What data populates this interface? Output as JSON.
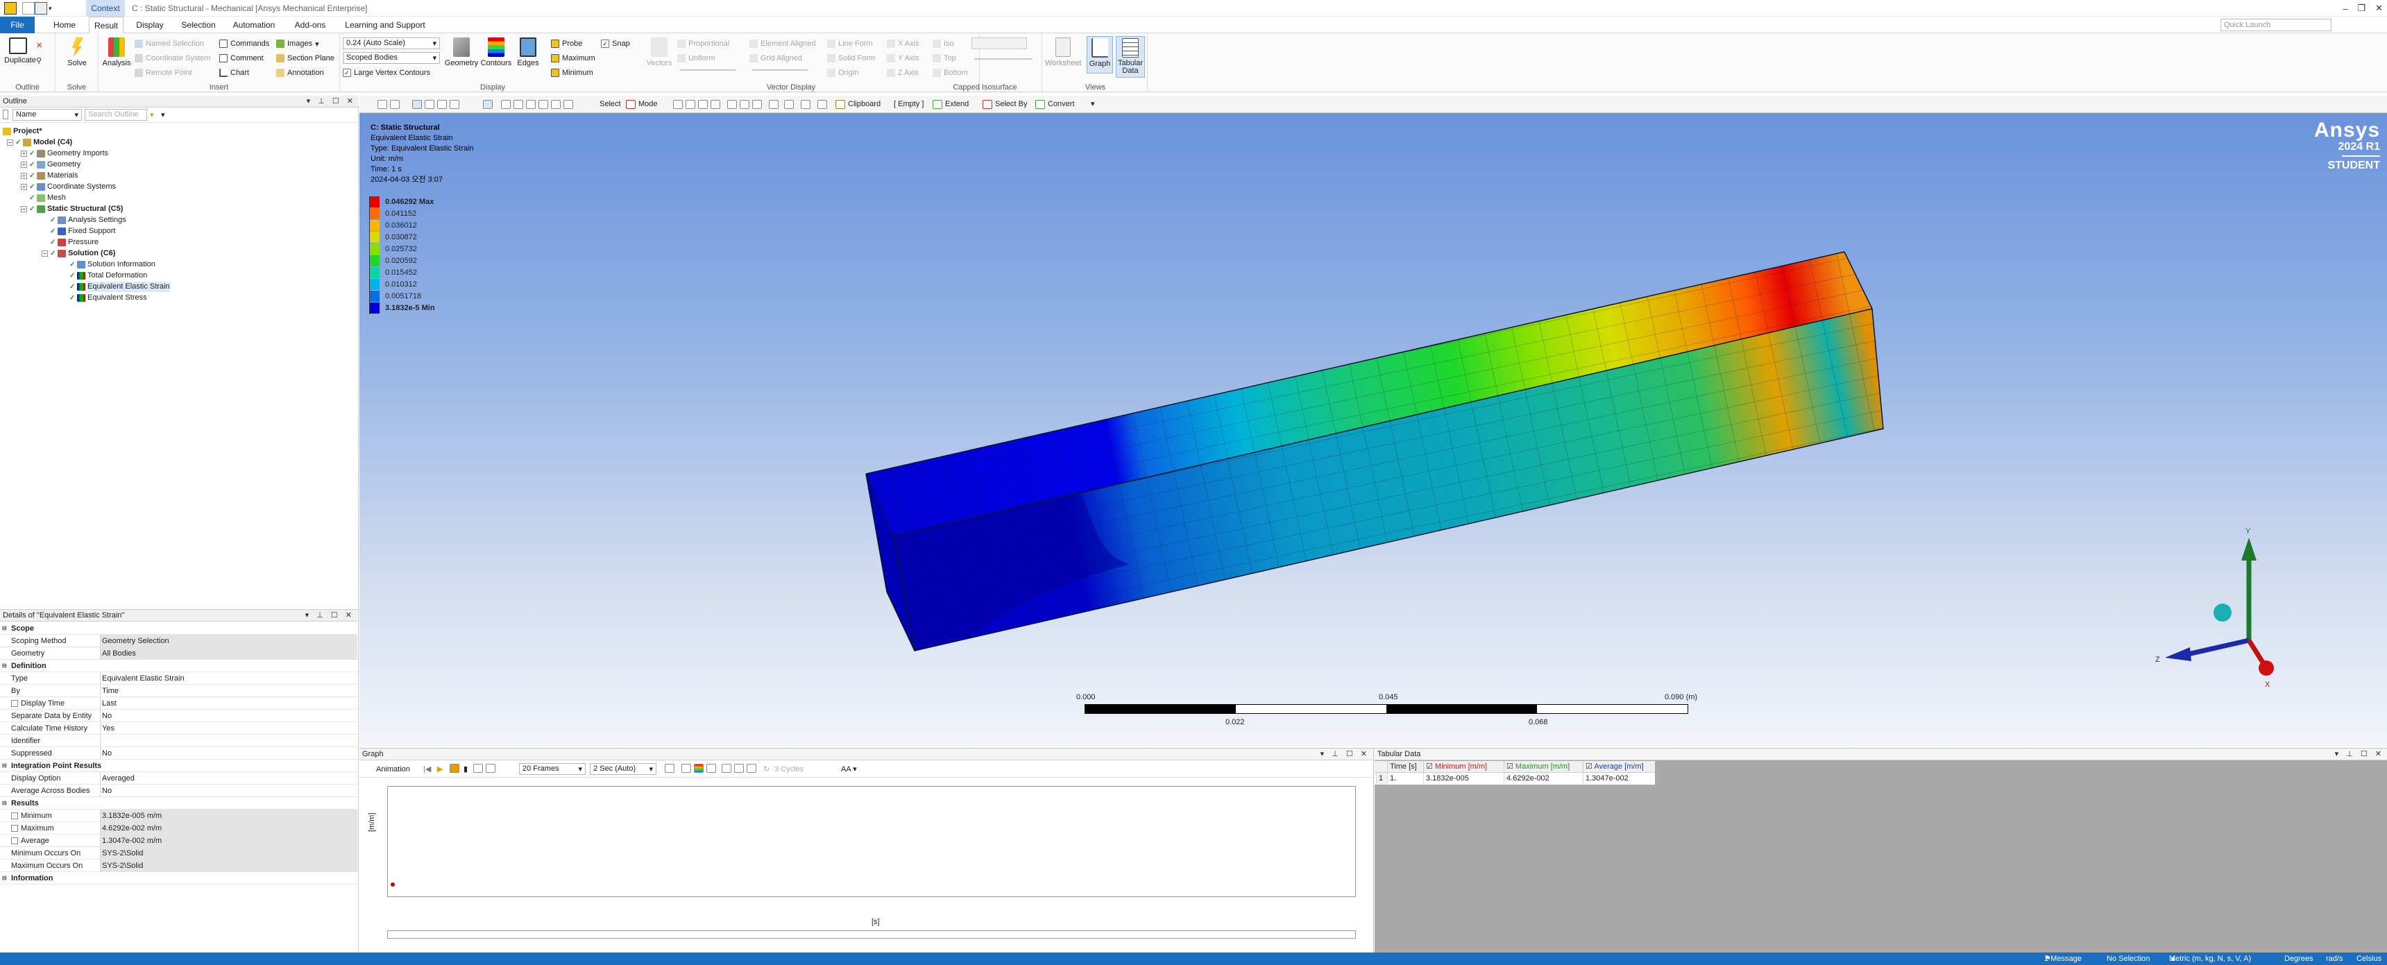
{
  "window": {
    "context_tab": "Context",
    "title": "C : Static Structural - Mechanical [Ansys Mechanical Enterprise]",
    "controls": [
      "–",
      "❐",
      "✕"
    ]
  },
  "menu": {
    "tabs": [
      "File",
      "Home",
      "Result",
      "Display",
      "Selection",
      "Automation",
      "Add-ons",
      "Learning and Support"
    ],
    "active": "Result",
    "quick_launch_placeholder": "Quick Launch"
  },
  "ribbon": {
    "outline_group": {
      "label": "Outline",
      "duplicate": "Duplicate"
    },
    "solve_group": {
      "label": "Solve",
      "solve": "Solve"
    },
    "insert_group": {
      "label": "Insert",
      "analysis": "Analysis",
      "named_selection": "Named Selection",
      "coordinate_system": "Coordinate System",
      "remote_point": "Remote Point",
      "commands": "Commands",
      "comment": "Comment",
      "chart": "Chart",
      "images": "Images",
      "section_plane": "Section Plane",
      "annotation": "Annotation"
    },
    "display_group": {
      "label": "Display",
      "scale_value": "0.24 (Auto Scale)",
      "scope_value": "Scoped Bodies",
      "large_vertex_contours": "Large Vertex Contours",
      "geometry": "Geometry",
      "contours": "Contours",
      "edges": "Edges",
      "probe": "Probe",
      "maximum": "Maximum",
      "minimum": "Minimum",
      "snap": "Snap"
    },
    "vector_group": {
      "label": "Vector Display",
      "vectors": "Vectors",
      "proportional": "Proportional",
      "uniform": "Uniform",
      "element_aligned": "Element Aligned",
      "grid_aligned": "Grid Aligned",
      "line_form": "Line Form",
      "solid_form": "Solid Form",
      "origin": "Origin",
      "x_axis": "X Axis",
      "y_axis": "Y Axis",
      "z_axis": "Z Axis"
    },
    "iso_group": {
      "label": "Capped Isosurface",
      "iso": "Iso",
      "top": "Top",
      "bottom": "Bottom"
    },
    "views_group": {
      "label": "Views",
      "worksheet": "Worksheet",
      "graph": "Graph",
      "tabular_data": "Tabular Data"
    }
  },
  "outline": {
    "title": "Outline",
    "filter_value": "Name",
    "search_placeholder": "Search Outline",
    "tree": [
      {
        "label": "Project*",
        "bold": true,
        "level": 0,
        "icon": "project-icon"
      },
      {
        "label": "Model (C4)",
        "bold": true,
        "level": 1,
        "icon": "model-icon"
      },
      {
        "label": "Geometry Imports",
        "level": 2,
        "icon": "geometry-imports-icon"
      },
      {
        "label": "Geometry",
        "level": 2,
        "icon": "geometry-icon"
      },
      {
        "label": "Materials",
        "level": 2,
        "icon": "materials-icon"
      },
      {
        "label": "Coordinate Systems",
        "level": 2,
        "icon": "coordinate-systems-icon"
      },
      {
        "label": "Mesh",
        "level": 2,
        "icon": "mesh-icon"
      },
      {
        "label": "Static Structural (C5)",
        "bold": true,
        "level": 2,
        "icon": "static-structural-icon"
      },
      {
        "label": "Analysis Settings",
        "level": 3,
        "icon": "analysis-settings-icon"
      },
      {
        "label": "Fixed Support",
        "level": 3,
        "icon": "fixed-support-icon"
      },
      {
        "label": "Pressure",
        "level": 3,
        "icon": "pressure-icon"
      },
      {
        "label": "Solution (C6)",
        "bold": true,
        "level": 3,
        "icon": "solution-icon"
      },
      {
        "label": "Solution Information",
        "level": 4,
        "icon": "solution-information-icon"
      },
      {
        "label": "Total Deformation",
        "level": 4,
        "icon": "total-deformation-icon"
      },
      {
        "label": "Equivalent Elastic Strain",
        "level": 4,
        "icon": "equivalent-elastic-strain-icon",
        "selected": true
      },
      {
        "label": "Equivalent Stress",
        "level": 4,
        "icon": "equivalent-stress-icon"
      }
    ]
  },
  "details": {
    "title": "Details of \"Equivalent Elastic Strain\"",
    "rows": [
      {
        "section": "Scope"
      },
      {
        "key": "Scoping Method",
        "value": "Geometry Selection",
        "gray": true
      },
      {
        "key": "Geometry",
        "value": "All Bodies",
        "gray": true
      },
      {
        "section": "Definition"
      },
      {
        "key": "Type",
        "value": "Equivalent Elastic Strain"
      },
      {
        "key": "By",
        "value": "Time"
      },
      {
        "key": "Display Time",
        "value": "Last",
        "checkbox": true
      },
      {
        "key": "Separate Data by Entity",
        "value": "No"
      },
      {
        "key": "Calculate Time History",
        "value": "Yes"
      },
      {
        "key": "Identifier",
        "value": ""
      },
      {
        "key": "Suppressed",
        "value": "No"
      },
      {
        "section": "Integration Point Results"
      },
      {
        "key": "Display Option",
        "value": "Averaged"
      },
      {
        "key": "Average Across Bodies",
        "value": "No"
      },
      {
        "section": "Results"
      },
      {
        "key": "Minimum",
        "value": "3.1832e-005 m/m",
        "gray": true,
        "checkbox": true
      },
      {
        "key": "Maximum",
        "value": "4.6292e-002 m/m",
        "gray": true,
        "checkbox": true
      },
      {
        "key": "Average",
        "value": "1.3047e-002 m/m",
        "gray": true,
        "checkbox": true
      },
      {
        "key": "Minimum Occurs On",
        "value": "SYS-2\\Solid",
        "gray": true
      },
      {
        "key": "Maximum Occurs On",
        "value": "SYS-2\\Solid",
        "gray": true
      },
      {
        "section": "Information"
      }
    ]
  },
  "viewport_toolbar": {
    "select": "Select",
    "mode": "Mode",
    "clipboard": "Clipboard",
    "empty": "[ Empty ]",
    "extend": "Extend",
    "select_by": "Select By",
    "convert": "Convert"
  },
  "result": {
    "analysis": "C: Static Structural",
    "name": "Equivalent Elastic Strain",
    "type": "Type: Equivalent Elastic Strain",
    "unit": "Unit: m/m",
    "time": "Time: 1 s",
    "date": "2024-04-03 오전 3:07",
    "legend": [
      {
        "label": "0.046292 Max",
        "color": "#e60000",
        "bold": true
      },
      {
        "label": "0.041152",
        "color": "#ff6a00"
      },
      {
        "label": "0.036012",
        "color": "#ffb400"
      },
      {
        "label": "0.030872",
        "color": "#d6dc00"
      },
      {
        "label": "0.025732",
        "color": "#88e000"
      },
      {
        "label": "0.020592",
        "color": "#1ed82a"
      },
      {
        "label": "0.015452",
        "color": "#00d8a8"
      },
      {
        "label": "0.010312",
        "color": "#00b4e8"
      },
      {
        "label": "0.0051718",
        "color": "#0070e8"
      },
      {
        "label": "3.1832e-5 Min",
        "color": "#0000d8",
        "bold": true
      }
    ]
  },
  "branding": {
    "brand": "Ansys",
    "version": "2024 R1",
    "edition": "STUDENT"
  },
  "scale_bar": {
    "top_labels": [
      "0.000",
      "0.045",
      "0.090 (m)"
    ],
    "bottom_labels": [
      "0.022",
      "0.068"
    ]
  },
  "triad": {
    "x": "X",
    "y": "Y",
    "z": "Z"
  },
  "graph": {
    "title": "Graph",
    "animation": "Animation",
    "frames": "20 Frames",
    "duration": "2 Sec (Auto)",
    "cycles": "3 Cycles",
    "y_label": "[m/m]",
    "x_label": "[s]"
  },
  "tabular": {
    "title": "Tabular Data",
    "columns": [
      "Time [s]",
      "Minimum [m/m]",
      "Maximum [m/m]",
      "Average [m/m]"
    ],
    "column_colors": [
      "#222222",
      "#c02020",
      "#1a9a1a",
      "#1a3cc0"
    ],
    "rows": [
      [
        "1",
        "1.",
        "3.1832e-005",
        "4.6292e-002",
        "1.3047e-002"
      ]
    ]
  },
  "status": {
    "messages": "1 Message",
    "selection": "No Selection",
    "units": "Metric (m, kg, N, s, V, A)",
    "angle": "Degrees",
    "rate": "rad/s",
    "temp": "Celsius"
  }
}
